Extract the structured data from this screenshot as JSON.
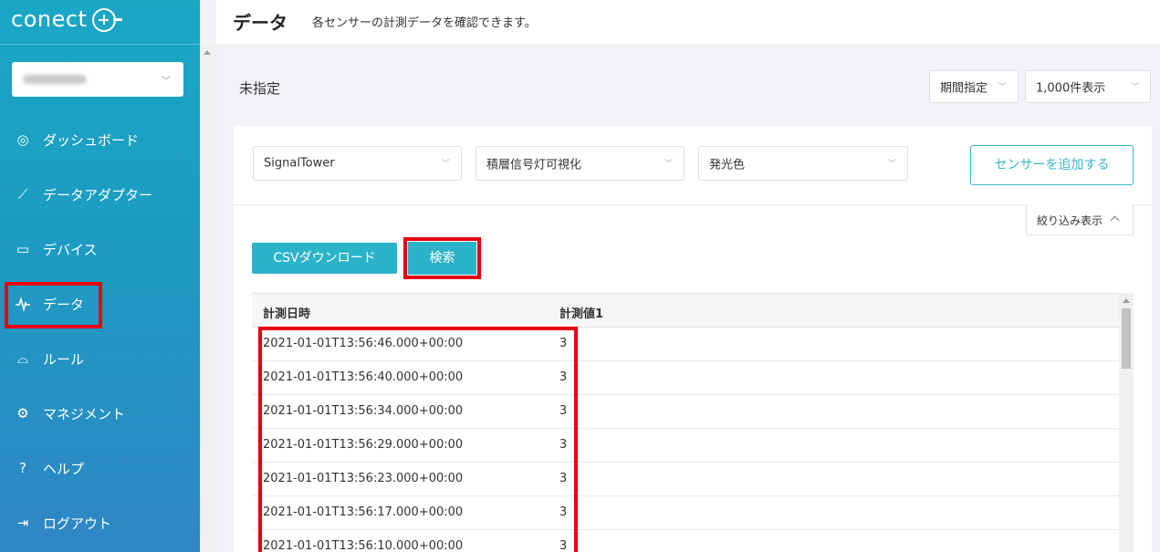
{
  "sidebar": {
    "logo_text": "conect",
    "nav": [
      {
        "label": "ダッシュボード",
        "icon": "dashboard-icon"
      },
      {
        "label": "データアダプター",
        "icon": "adapter-icon"
      },
      {
        "label": "デバイス",
        "icon": "device-icon"
      },
      {
        "label": "データ",
        "icon": "pulse-icon"
      },
      {
        "label": "ルール",
        "icon": "rule-icon"
      },
      {
        "label": "マネジメント",
        "icon": "gear-icon"
      },
      {
        "label": "ヘルプ",
        "icon": "help-icon"
      },
      {
        "label": "ログアウト",
        "icon": "logout-icon"
      }
    ]
  },
  "header": {
    "title": "データ",
    "description": "各センサーの計測データを確認できます。"
  },
  "toolbar": {
    "unspecified_label": "未指定",
    "period_select": "期間指定",
    "count_select": "1,000件表示"
  },
  "filters": {
    "device": "SignalTower",
    "adapter": "積層信号灯可視化",
    "sensor": "発光色",
    "add_sensor_label": "センサーを追加する",
    "filter_toggle_label": "絞り込み表示"
  },
  "actions": {
    "csv_label": "CSVダウンロード",
    "search_label": "検索"
  },
  "table": {
    "headers": [
      "計測日時",
      "計測値1"
    ],
    "rows": [
      [
        "2021-01-01T13:56:46.000+00:00",
        "3"
      ],
      [
        "2021-01-01T13:56:40.000+00:00",
        "3"
      ],
      [
        "2021-01-01T13:56:34.000+00:00",
        "3"
      ],
      [
        "2021-01-01T13:56:29.000+00:00",
        "3"
      ],
      [
        "2021-01-01T13:56:23.000+00:00",
        "3"
      ],
      [
        "2021-01-01T13:56:17.000+00:00",
        "3"
      ],
      [
        "2021-01-01T13:56:10.000+00:00",
        "3"
      ]
    ]
  },
  "colors": {
    "accent": "#2bb3c9",
    "highlight_box": "#e60012"
  }
}
